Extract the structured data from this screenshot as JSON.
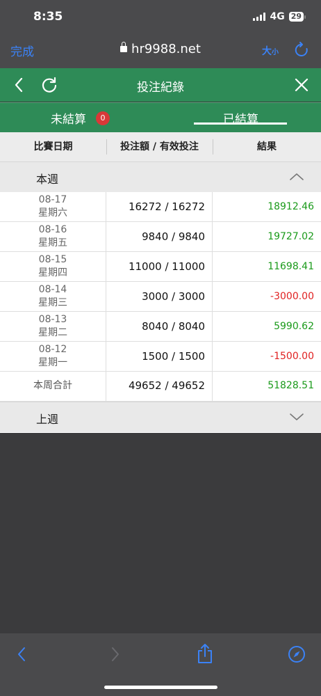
{
  "status": {
    "time": "8:35",
    "network": "4G",
    "battery": "29"
  },
  "browser": {
    "done_label": "完成",
    "url": "hr9988.net",
    "textsize_big": "大",
    "textsize_small": "小"
  },
  "header": {
    "title": "投注紀錄"
  },
  "tabs": {
    "unsettled": "未結算",
    "unsettled_count": "0",
    "settled": "已結算"
  },
  "table": {
    "columns": [
      "比賽日期",
      "投注額 / 有效投注",
      "結果"
    ],
    "this_week_label": "本週",
    "last_week_label": "上週",
    "rows": [
      {
        "date": "08-17",
        "weekday": "星期六",
        "bet": "16272 / 16272",
        "result": "18912.46"
      },
      {
        "date": "08-16",
        "weekday": "星期五",
        "bet": "9840 / 9840",
        "result": "19727.02"
      },
      {
        "date": "08-15",
        "weekday": "星期四",
        "bet": "11000 / 11000",
        "result": "11698.41"
      },
      {
        "date": "08-14",
        "weekday": "星期三",
        "bet": "3000 / 3000",
        "result": "-3000.00"
      },
      {
        "date": "08-13",
        "weekday": "星期二",
        "bet": "8040 / 8040",
        "result": "5990.62"
      },
      {
        "date": "08-12",
        "weekday": "星期一",
        "bet": "1500 / 1500",
        "result": "-1500.00"
      }
    ],
    "total": {
      "label": "本周合計",
      "bet": "49652 / 49652",
      "result": "51828.51"
    }
  },
  "colors": {
    "header_green": "#2e8b57",
    "positive": "#1a9a1a",
    "negative": "#e02020",
    "ios_blue": "#3b82f6",
    "badge_red": "#d93838"
  }
}
